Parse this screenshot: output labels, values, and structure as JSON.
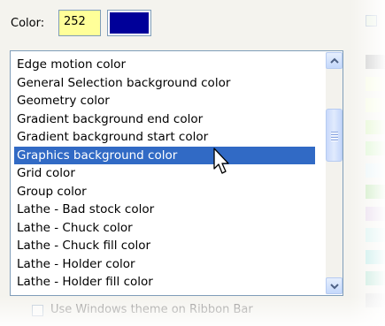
{
  "color_field": {
    "label": "Color:",
    "value": "252",
    "swatch_color": "#000099"
  },
  "color_list": {
    "items": [
      "Edge motion color",
      "General Selection background color",
      "Geometry color",
      "Gradient background end color",
      "Gradient background start color",
      "Graphics background color",
      "Grid color",
      "Group color",
      "Lathe - Bad stock color",
      "Lathe - Chuck color",
      "Lathe - Chuck fill color",
      "Lathe - Holder color",
      "Lathe - Holder fill color"
    ],
    "selected_item": "Graphics background color",
    "selection_color": "#316ac5"
  },
  "bottom_option": {
    "label": "Use Windows theme on Ribbon Bar"
  },
  "right_swatches": [
    "#c4c4c4",
    "#f7fbe2",
    "#f6fbe3",
    "#dff5c8",
    "#d9f5cc",
    "#e8f4f7",
    "#c4e7b8",
    "#e5d7ea",
    "#d6f1ee",
    "#bde9e6",
    "#bfe6d8",
    "#e3e3e3"
  ]
}
